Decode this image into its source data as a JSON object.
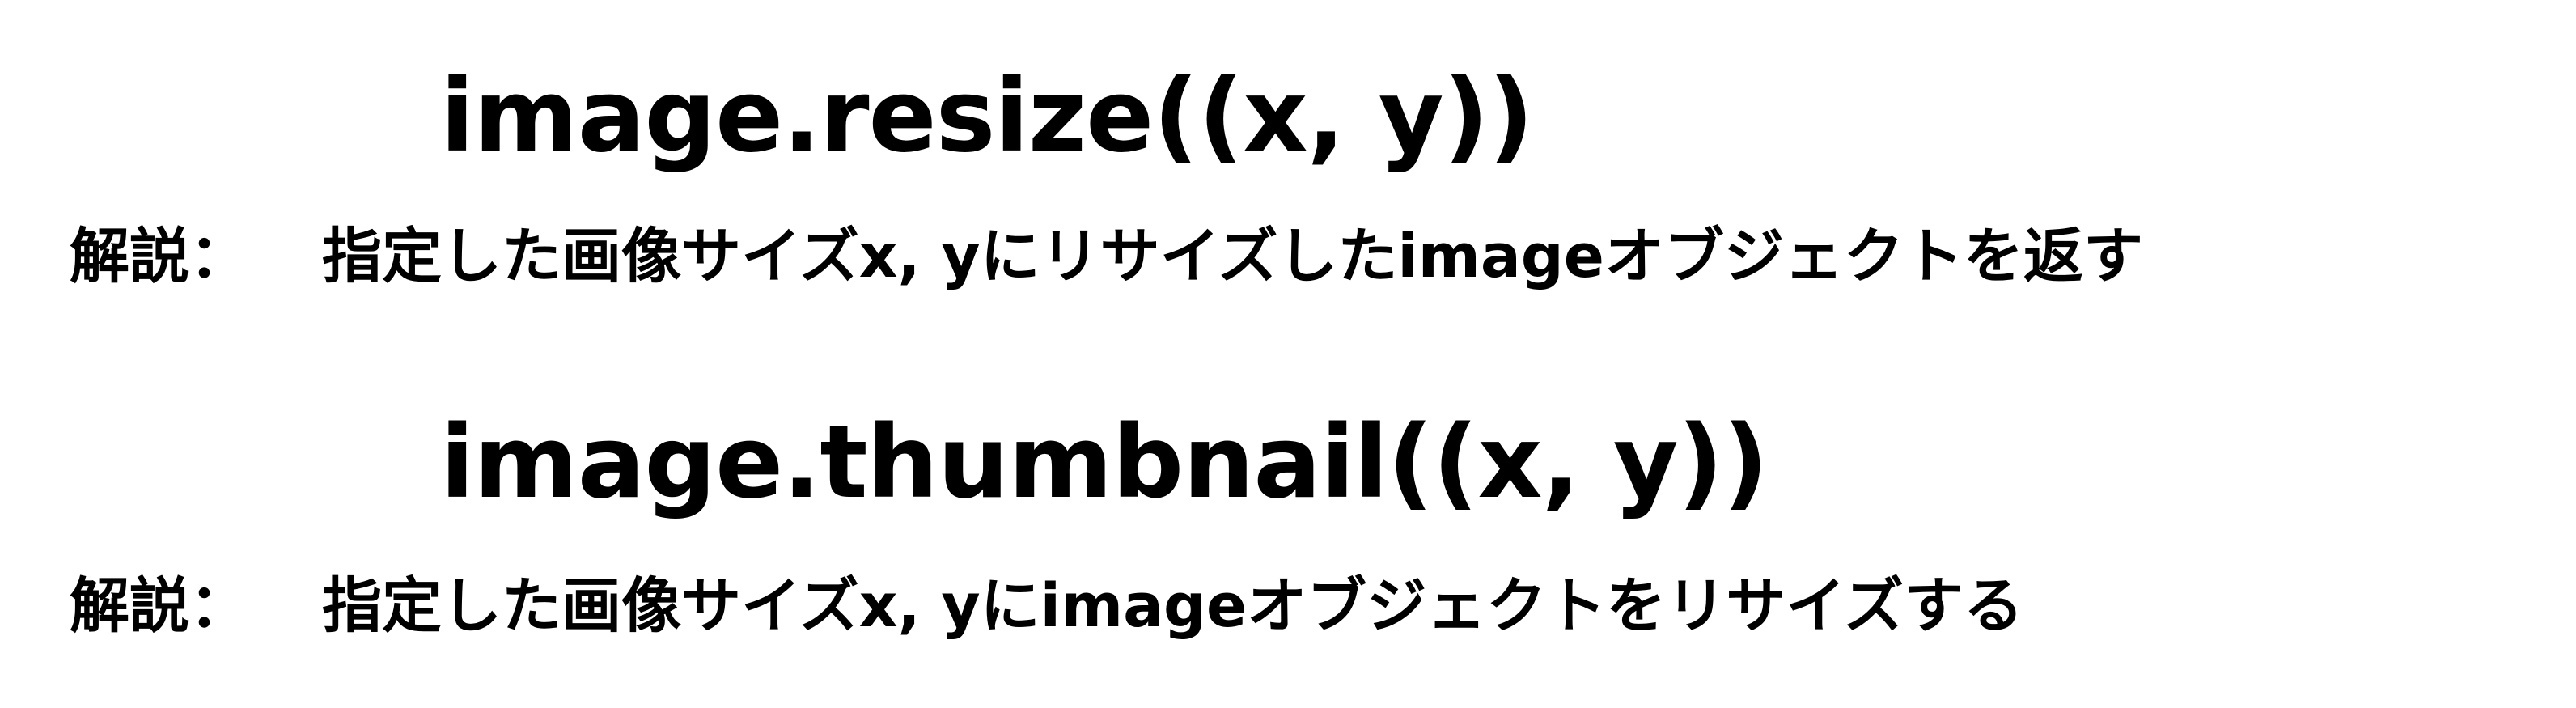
{
  "entries": [
    {
      "code": "image.resize((x, y))",
      "label": "解説：",
      "description": "指定した画像サイズx, yにリサイズしたimageオブジェクトを返す"
    },
    {
      "code": "image.thumbnail((x, y))",
      "label": "解説：",
      "description": "指定した画像サイズx, yにimageオブジェクトをリサイズする"
    }
  ]
}
